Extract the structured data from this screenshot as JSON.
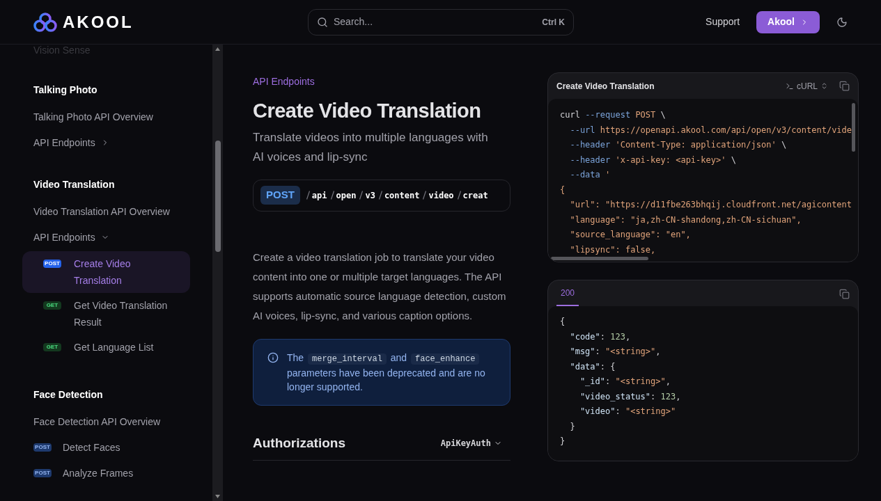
{
  "header": {
    "logo": "AKOOL",
    "search": {
      "placeholder": "Search...",
      "shortcut": "Ctrl K"
    },
    "support": "Support",
    "cta": "Akool"
  },
  "sidebar": {
    "faded_item": "Vision Sense",
    "sections": [
      {
        "title": "Talking Photo",
        "items": [
          {
            "label": "Talking Photo API Overview"
          },
          {
            "label": "API Endpoints",
            "expanded": false
          }
        ]
      },
      {
        "title": "Video Translation",
        "items": [
          {
            "label": "Video Translation API Overview"
          },
          {
            "label": "API Endpoints",
            "expanded": true,
            "children": [
              {
                "method": "POST",
                "label": "Create Video Translation",
                "selected": true
              },
              {
                "method": "GET",
                "label": "Get Video Translation Result",
                "selected": false
              },
              {
                "method": "GET",
                "label": "Get Language List",
                "selected": false
              }
            ]
          }
        ]
      },
      {
        "title": "Face Detection",
        "items": [
          {
            "label": "Face Detection API Overview"
          },
          {
            "method": "POST",
            "label": "Detect Faces"
          },
          {
            "method": "POST",
            "label": "Analyze Frames"
          }
        ]
      }
    ]
  },
  "page": {
    "eyebrow": "API Endpoints",
    "title": "Create Video Translation",
    "subtitle": "Translate videos into multiple languages with AI voices and lip-sync",
    "endpoint": {
      "method": "POST",
      "segments": [
        "api",
        "open",
        "v3",
        "content",
        "video",
        "creat"
      ]
    },
    "description": "Create a video translation job to translate your video content into one or multiple target languages. The API supports automatic source language detection, custom AI voices, lip-sync, and various caption options.",
    "notice": {
      "parts": [
        {
          "kind": "text",
          "text": "The"
        },
        {
          "kind": "code",
          "text": "merge_interval"
        },
        {
          "kind": "text",
          "text": "and"
        },
        {
          "kind": "code",
          "text": "face_enhance"
        },
        {
          "kind": "text",
          "text": "parameters have been deprecated and are no longer supported."
        }
      ]
    },
    "authorizations": {
      "title": "Authorizations",
      "scheme": "ApiKeyAuth"
    }
  },
  "request_panel": {
    "title": "Create Video Translation",
    "language": "cURL",
    "lines": [
      [
        {
          "kind": "plain",
          "text": "curl "
        },
        {
          "kind": "flag",
          "text": "--request "
        },
        {
          "kind": "str",
          "text": "POST "
        },
        {
          "kind": "plain",
          "text": "\\"
        }
      ],
      [
        {
          "kind": "flag",
          "text": "  --url "
        },
        {
          "kind": "str",
          "text": "https://openapi.akool.com/api/open/v3/content/vide"
        }
      ],
      [
        {
          "kind": "flag",
          "text": "  --header "
        },
        {
          "kind": "str",
          "text": "'Content-Type: application/json' "
        },
        {
          "kind": "plain",
          "text": "\\"
        }
      ],
      [
        {
          "kind": "flag",
          "text": "  --header "
        },
        {
          "kind": "str",
          "text": "'x-api-key: <api-key>' "
        },
        {
          "kind": "plain",
          "text": "\\"
        }
      ],
      [
        {
          "kind": "flag",
          "text": "  --data "
        },
        {
          "kind": "str",
          "text": "'"
        }
      ],
      [
        {
          "kind": "str",
          "text": "{"
        }
      ],
      [
        {
          "kind": "str",
          "text": "  \"url\": \"https://d11fbe263bhqij.cloudfront.net/agicontent"
        }
      ],
      [
        {
          "kind": "str",
          "text": "  \"language\": \"ja,zh-CN-shandong,zh-CN-sichuan\","
        }
      ],
      [
        {
          "kind": "str",
          "text": "  \"source_language\": \"en\","
        }
      ],
      [
        {
          "kind": "str",
          "text": "  \"lipsync\": false,"
        }
      ]
    ]
  },
  "response_panel": {
    "status": "200",
    "lines": [
      [
        {
          "kind": "plain",
          "text": "{"
        }
      ],
      [
        {
          "kind": "key",
          "text": "  \"code\""
        },
        {
          "kind": "plain",
          "text": ": "
        },
        {
          "kind": "num",
          "text": "123"
        },
        {
          "kind": "plain",
          "text": ","
        }
      ],
      [
        {
          "kind": "key",
          "text": "  \"msg\""
        },
        {
          "kind": "plain",
          "text": ": "
        },
        {
          "kind": "str",
          "text": "\"<string>\""
        },
        {
          "kind": "plain",
          "text": ","
        }
      ],
      [
        {
          "kind": "key",
          "text": "  \"data\""
        },
        {
          "kind": "plain",
          "text": ": {"
        }
      ],
      [
        {
          "kind": "key",
          "text": "    \"_id\""
        },
        {
          "kind": "plain",
          "text": ": "
        },
        {
          "kind": "str",
          "text": "\"<string>\""
        },
        {
          "kind": "plain",
          "text": ","
        }
      ],
      [
        {
          "kind": "key",
          "text": "    \"video_status\""
        },
        {
          "kind": "plain",
          "text": ": "
        },
        {
          "kind": "num",
          "text": "123"
        },
        {
          "kind": "plain",
          "text": ","
        }
      ],
      [
        {
          "kind": "key",
          "text": "    \"video\""
        },
        {
          "kind": "plain",
          "text": ": "
        },
        {
          "kind": "str",
          "text": "\"<string>\""
        }
      ],
      [
        {
          "kind": "plain",
          "text": "  }"
        }
      ],
      [
        {
          "kind": "plain",
          "text": "}"
        }
      ]
    ]
  }
}
